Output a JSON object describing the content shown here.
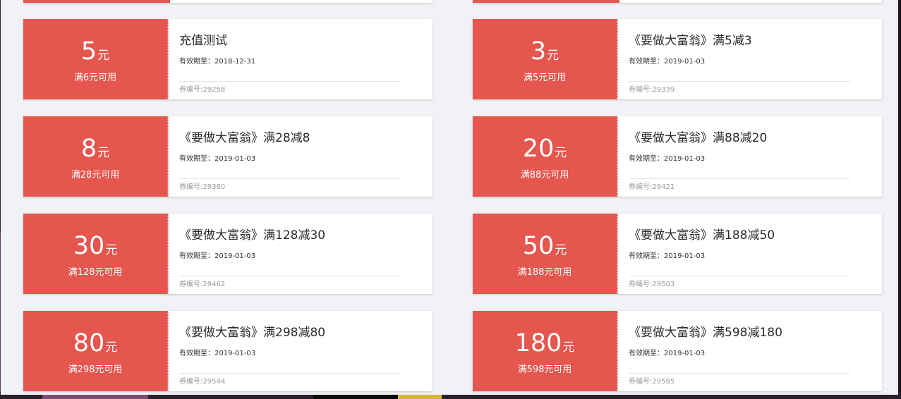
{
  "coupon_list": {
    "label_prefixes": {
      "expiry": "有效期至：",
      "code": "券编号:"
    },
    "coupons": [
      {
        "amount": "5",
        "unit": "元",
        "condition": "满6元可用",
        "title": "充值测试",
        "expiry": "有效期至：2018-12-31",
        "code": "券编号:29258"
      },
      {
        "amount": "3",
        "unit": "元",
        "condition": "满5元可用",
        "title": "《要做大富翁》满5减3",
        "expiry": "有效期至：2019-01-03",
        "code": "券编号:29339"
      },
      {
        "amount": "8",
        "unit": "元",
        "condition": "满28元可用",
        "title": "《要做大富翁》满28减8",
        "expiry": "有效期至：2019-01-03",
        "code": "券编号:29380"
      },
      {
        "amount": "20",
        "unit": "元",
        "condition": "满88元可用",
        "title": "《要做大富翁》满88减20",
        "expiry": "有效期至：2019-01-03",
        "code": "券编号:29421"
      },
      {
        "amount": "30",
        "unit": "元",
        "condition": "满128元可用",
        "title": "《要做大富翁》满128减30",
        "expiry": "有效期至：2019-01-03",
        "code": "券编号:29462"
      },
      {
        "amount": "50",
        "unit": "元",
        "condition": "满188元可用",
        "title": "《要做大富翁》满188减50",
        "expiry": "有效期至：2019-01-03",
        "code": "券编号:29503"
      },
      {
        "amount": "80",
        "unit": "元",
        "condition": "满298元可用",
        "title": "《要做大富翁》满298减80",
        "expiry": "有效期至：2019-01-03",
        "code": "券编号:29544"
      },
      {
        "amount": "180",
        "unit": "元",
        "condition": "满598元可用",
        "title": "《要做大富翁》满598减180",
        "expiry": "有效期至：2019-01-03",
        "code": "券编号:29585"
      }
    ]
  },
  "colors": {
    "coupon_red": "#e5564e",
    "page_background": "#f1f2f6"
  }
}
